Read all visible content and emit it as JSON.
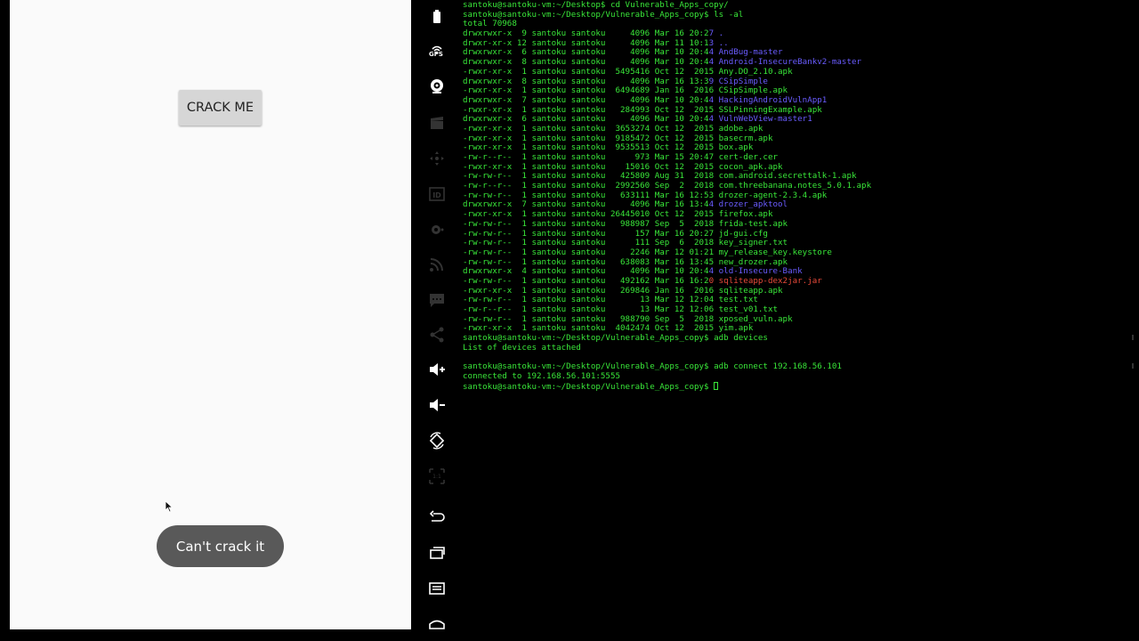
{
  "app": {
    "crack_button_label": "CRACK ME",
    "toast_text": "Can't crack it"
  },
  "toolbar": {
    "gps_label": "GPS",
    "icons": [
      "battery-icon",
      "gps-icon",
      "camera-icon",
      "clapperboard-icon",
      "move-icon",
      "id-icon",
      "settings-cog-icon",
      "rss-icon",
      "sms-icon",
      "share-icon",
      "volume-up-icon",
      "volume-down-icon",
      "rotate-icon",
      "scale-icon",
      "back-icon",
      "recent-apps-icon",
      "menu-icon",
      "home-icon"
    ]
  },
  "terminal": {
    "lines": [
      "santoku@santoku-vm:~/Desktop$ cd Vulnerable_Apps_copy/",
      "santoku@santoku-vm:~/Desktop/Vulnerable_Apps_copy$ ls -al",
      "total 70968",
      "drwxrwxr-x  9 santoku santoku     4096 Mar 16 20:27 .",
      "drwxr-xr-x 12 santoku santoku     4096 Mar 11 10:13 ..",
      "drwxrwxr-x  6 santoku santoku     4096 Mar 10 20:44 AndBug-master",
      "drwxrwxr-x  8 santoku santoku     4096 Mar 10 20:44 Android-InsecureBankv2-master",
      "-rwxr-xr-x  1 santoku santoku  5495416 Oct 12  2015 Any.DO_2.10.apk",
      "drwxrwxr-x  8 santoku santoku     4096 Mar 16 13:39 CSipSimple",
      "-rwxr-xr-x  1 santoku santoku  6494689 Jan 16  2016 CSipSimple.apk",
      "drwxrwxr-x  7 santoku santoku     4096 Mar 10 20:44 HackingAndroidVulnApp1",
      "-rwxr-xr-x  1 santoku santoku   284993 Oct 12  2015 SSLPinningExample.apk",
      "drwxrwxr-x  6 santoku santoku     4096 Mar 10 20:44 VulnWebView-master1",
      "-rwxr-xr-x  1 santoku santoku  3653274 Oct 12  2015 adobe.apk",
      "-rwxr-xr-x  1 santoku santoku  9185472 Oct 12  2015 basecrm.apk",
      "-rwxr-xr-x  1 santoku santoku  9535513 Oct 12  2015 box.apk",
      "-rw-r--r--  1 santoku santoku      973 Mar 15 20:47 cert-der.cer",
      "-rwxr-xr-x  1 santoku santoku    15016 Oct 12  2015 cocon_apk.apk",
      "-rw-rw-r--  1 santoku santoku   425809 Aug 31  2018 com.android.secrettalk-1.apk",
      "-rw-r--r--  1 santoku santoku  2992560 Sep  2  2018 com.threebanana.notes_5.0.1.apk",
      "-rw-rw-r--  1 santoku santoku   633111 Mar 16 12:53 drozer-agent-2.3.4.apk",
      "drwxrwxr-x  7 santoku santoku     4096 Mar 16 13:44 drozer_apktool",
      "-rwxr-xr-x  1 santoku santoku 26445010 Oct 12  2015 firefox.apk",
      "-rw-rw-r--  1 santoku santoku   988987 Sep  5  2018 frida-test.apk",
      "-rw-rw-r--  1 santoku santoku      157 Mar 16 20:27 jd-gui.cfg",
      "-rw-rw-r--  1 santoku santoku      111 Sep  6  2018 key_signer.txt",
      "-rw-rw-r--  1 santoku santoku     2246 Mar 12 01:21 my_release_key.keystore",
      "-rw-rw-r--  1 santoku santoku   638083 Mar 16 13:45 new_drozer.apk",
      "drwxrwxr-x  4 santoku santoku     4096 Mar 10 20:44 old-Insecure-Bank",
      "-rw-rw-r--  1 santoku santoku   492162 Mar 16 16:20 sqliteapp-dex2jar.jar",
      "-rwxr-xr-x  1 santoku santoku   269846 Jan 16  2016 sqliteapp.apk",
      "-rw-rw-r--  1 santoku santoku       13 Mar 12 12:04 test.txt",
      "-rw-r--r--  1 santoku santoku       13 Mar 12 12:06 test_v01.txt",
      "-rw-rw-r--  1 santoku santoku   988790 Sep  5  2018 xposed_vuln.apk",
      "-rwxr-xr-x  1 santoku santoku  4042474 Oct 12  2015 yim.apk",
      "santoku@santoku-vm:~/Desktop/Vulnerable_Apps_copy$ adb devices",
      "List of devices attached",
      "",
      "santoku@santoku-vm:~/Desktop/Vulnerable_Apps_copy$ adb connect 192.168.56.101",
      "connected to 192.168.56.101:5555",
      "santoku@santoku-vm:~/Desktop/Vulnerable_Apps_copy$ "
    ],
    "dir_line_indices": [
      3,
      4,
      5,
      6,
      8,
      10,
      12,
      21,
      28
    ],
    "red_line_indices": [
      29
    ],
    "colors": {
      "text": "#39e639",
      "dir": "#6a5cff",
      "red": "#e84a3a",
      "background": "#000000"
    }
  }
}
